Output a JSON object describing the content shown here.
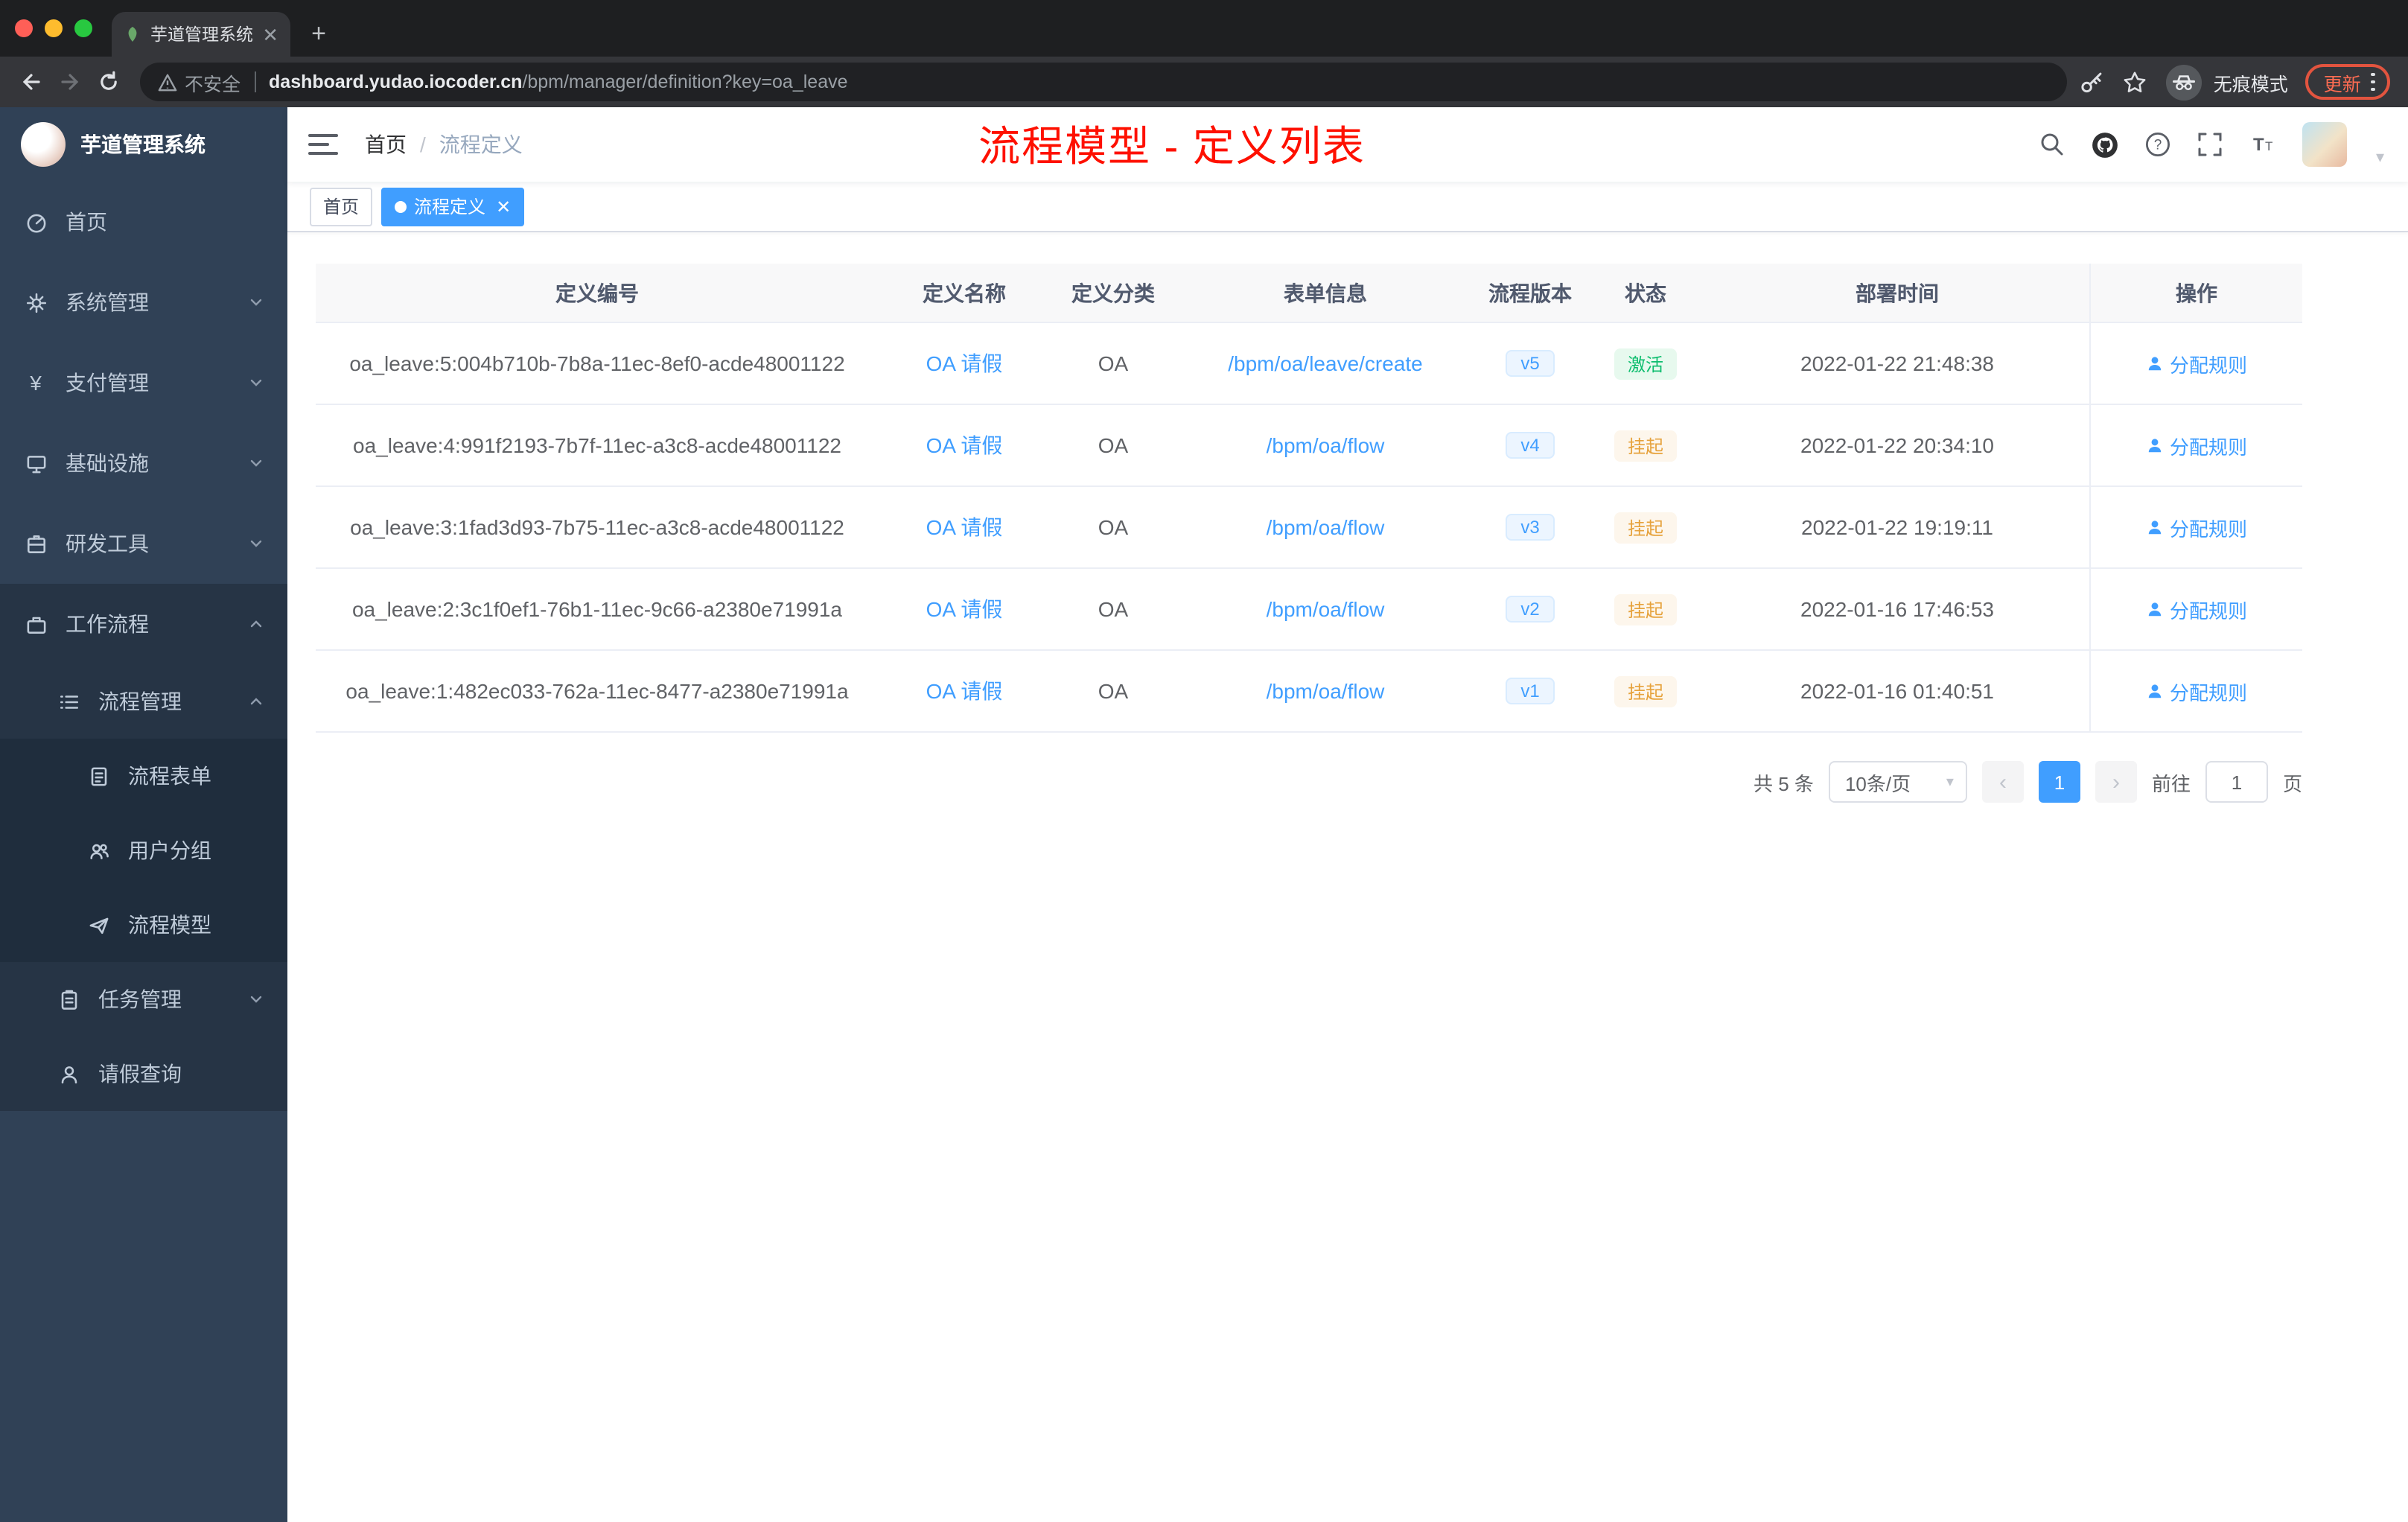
{
  "browser": {
    "tab_title": "芋道管理系统",
    "security_label": "不安全",
    "url_domain": "dashboard.yudao.iocoder.cn",
    "url_path": "/bpm/manager/definition?key=oa_leave",
    "incognito_label": "无痕模式",
    "update_label": "更新"
  },
  "sidebar": {
    "logo_title": "芋道管理系统",
    "items": [
      {
        "label": "首页"
      },
      {
        "label": "系统管理"
      },
      {
        "label": "支付管理"
      },
      {
        "label": "基础设施"
      },
      {
        "label": "研发工具"
      },
      {
        "label": "工作流程"
      },
      {
        "label": "流程管理"
      },
      {
        "label": "流程表单"
      },
      {
        "label": "用户分组"
      },
      {
        "label": "流程模型"
      },
      {
        "label": "任务管理"
      },
      {
        "label": "请假查询"
      }
    ]
  },
  "header": {
    "breadcrumb": {
      "home": "首页",
      "separator": "/",
      "current": "流程定义"
    },
    "annotation": "流程模型 - 定义列表"
  },
  "tags": {
    "home": "首页",
    "active": "流程定义"
  },
  "table": {
    "columns": [
      "定义编号",
      "定义名称",
      "定义分类",
      "表单信息",
      "流程版本",
      "状态",
      "部署时间",
      "操作"
    ],
    "rows": [
      {
        "id": "oa_leave:5:004b710b-7b8a-11ec-8ef0-acde48001122",
        "name": "OA 请假",
        "category": "OA",
        "form": "/bpm/oa/leave/create",
        "version": "v5",
        "status": "激活",
        "deploy_time": "2022-01-22 21:48:38",
        "action": "分配规则"
      },
      {
        "id": "oa_leave:4:991f2193-7b7f-11ec-a3c8-acde48001122",
        "name": "OA 请假",
        "category": "OA",
        "form": "/bpm/oa/flow",
        "version": "v4",
        "status": "挂起",
        "deploy_time": "2022-01-22 20:34:10",
        "action": "分配规则"
      },
      {
        "id": "oa_leave:3:1fad3d93-7b75-11ec-a3c8-acde48001122",
        "name": "OA 请假",
        "category": "OA",
        "form": "/bpm/oa/flow",
        "version": "v3",
        "status": "挂起",
        "deploy_time": "2022-01-22 19:19:11",
        "action": "分配规则"
      },
      {
        "id": "oa_leave:2:3c1f0ef1-76b1-11ec-9c66-a2380e71991a",
        "name": "OA 请假",
        "category": "OA",
        "form": "/bpm/oa/flow",
        "version": "v2",
        "status": "挂起",
        "deploy_time": "2022-01-16 17:46:53",
        "action": "分配规则"
      },
      {
        "id": "oa_leave:1:482ec033-762a-11ec-8477-a2380e71991a",
        "name": "OA 请假",
        "category": "OA",
        "form": "/bpm/oa/flow",
        "version": "v1",
        "status": "挂起",
        "deploy_time": "2022-01-16 01:40:51",
        "action": "分配规则"
      }
    ]
  },
  "pagination": {
    "total": "共 5 条",
    "page_size": "10条/页",
    "current_page": "1",
    "goto_label": "前往",
    "page_unit": "页",
    "goto_value": "1"
  },
  "colors": {
    "accent": "#409eff",
    "success": "#0dbd6e",
    "warning": "#e6a23c",
    "annotation": "#ff1000",
    "sidebar_bg": "#304156"
  }
}
